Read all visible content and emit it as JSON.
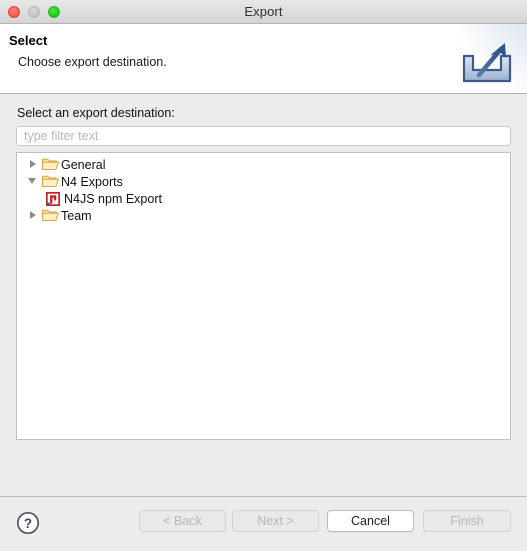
{
  "window": {
    "title": "Export",
    "controls": {
      "close": "close-button",
      "minimize": "minimize-button",
      "zoom": "zoom-button"
    }
  },
  "header": {
    "title": "Select",
    "subtitle": "Choose export destination.",
    "icon": "export-wizard-icon"
  },
  "main": {
    "destination_label": "Select an export destination:",
    "filter": {
      "value": "",
      "placeholder": "type filter text"
    },
    "tree": [
      {
        "label": "General",
        "level": 1,
        "icon": "folder-icon",
        "expanded": false,
        "twisty": "collapsed"
      },
      {
        "label": "N4 Exports",
        "level": 1,
        "icon": "folder-icon",
        "expanded": true,
        "twisty": "expanded"
      },
      {
        "label": "N4JS npm Export",
        "level": 2,
        "icon": "npm-icon",
        "expanded": false,
        "twisty": "none"
      },
      {
        "label": "Team",
        "level": 1,
        "icon": "folder-icon",
        "expanded": false,
        "twisty": "collapsed"
      }
    ]
  },
  "footer": {
    "help_label": "?",
    "help_icon": "help-icon",
    "buttons": {
      "back": "< Back",
      "next": "Next >",
      "cancel": "Cancel",
      "finish": "Finish"
    }
  },
  "colors": {
    "npm_red": "#c12127",
    "folder": "#e8a33d",
    "dialog_bg": "#ececec",
    "accent_blue": "#3b5a8f"
  }
}
